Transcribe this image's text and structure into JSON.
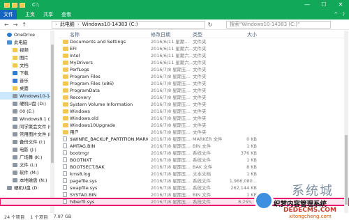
{
  "window": {
    "title": "C:\\",
    "controls": [
      "—",
      "☐",
      "✕"
    ]
  },
  "ribbon": {
    "file_tab": "文件",
    "tabs": [
      "主页",
      "共享",
      "查看"
    ],
    "right": [
      "^",
      "?"
    ]
  },
  "address": {
    "path": [
      "此电脑",
      "Windows10-14383 (C:)"
    ],
    "search_placeholder": "搜索\"Windows10-14383 (C:)\""
  },
  "nav": [
    {
      "label": "OneDrive",
      "icon": "cloud",
      "sub": false,
      "selected": false
    },
    {
      "label": "此电脑",
      "icon": "pc",
      "sub": false,
      "selected": false
    },
    {
      "label": "视频",
      "icon": "folder",
      "sub": true,
      "selected": false
    },
    {
      "label": "图片",
      "icon": "folder",
      "sub": true,
      "selected": false
    },
    {
      "label": "文档",
      "icon": "folder",
      "sub": true,
      "selected": false
    },
    {
      "label": "下载",
      "icon": "dl",
      "sub": true,
      "selected": false
    },
    {
      "label": "音乐",
      "icon": "music",
      "sub": true,
      "selected": false
    },
    {
      "label": "桌面",
      "icon": "folder",
      "sub": true,
      "selected": false
    },
    {
      "label": "Windows10-14",
      "icon": "drive",
      "sub": true,
      "selected": true
    },
    {
      "label": "硬机U盘 (D:)",
      "icon": "drive",
      "sub": true,
      "selected": false
    },
    {
      "label": "00 (E:)",
      "icon": "drive",
      "sub": true,
      "selected": false
    },
    {
      "label": "Windows8.1 (F",
      "icon": "drive",
      "sub": true,
      "selected": false
    },
    {
      "label": "同学聚会文件 (G",
      "icon": "drive",
      "sub": true,
      "selected": false
    },
    {
      "label": "常用图片文件 (H",
      "icon": "drive",
      "sub": true,
      "selected": false
    },
    {
      "label": "备份文件 (I:)",
      "icon": "drive",
      "sub": true,
      "selected": false
    },
    {
      "label": "电影 (J:)",
      "icon": "drive",
      "sub": true,
      "selected": false
    },
    {
      "label": "广场舞 (K:)",
      "icon": "drive",
      "sub": true,
      "selected": false
    },
    {
      "label": "文件 (L:)",
      "icon": "drive",
      "sub": true,
      "selected": false
    },
    {
      "label": "软件 (M:)",
      "icon": "drive",
      "sub": true,
      "selected": false
    },
    {
      "label": "本地磁盘 (N:)",
      "icon": "drive",
      "sub": true,
      "selected": false
    },
    {
      "label": "硬机U盘 (D:",
      "icon": "drive",
      "sub": false,
      "selected": false
    }
  ],
  "columns": {
    "name": "名称",
    "date": "修改日期",
    "type": "类型",
    "size": "大小"
  },
  "files": [
    {
      "name": "Documents and Settings",
      "date": "2016/6/11 星期...",
      "type": "文件夹",
      "size": "",
      "kind": "folder"
    },
    {
      "name": "EFI",
      "date": "2016/6/11 星期六...",
      "type": "文件夹",
      "size": "",
      "kind": "folder"
    },
    {
      "name": "Intel",
      "date": "2016/6/11 星期六...",
      "type": "文件夹",
      "size": "",
      "kind": "folder"
    },
    {
      "name": "MyDrivers",
      "date": "2016/6/11 星期六...",
      "type": "文件夹",
      "size": "",
      "kind": "folder"
    },
    {
      "name": "PerfLogs",
      "date": "2016/7/8 星期五...",
      "type": "文件夹",
      "size": "",
      "kind": "folder"
    },
    {
      "name": "Program Files",
      "date": "2016/7/8 星期五...",
      "type": "文件夹",
      "size": "",
      "kind": "folder"
    },
    {
      "name": "Program Files (x86)",
      "date": "2016/7/8 星期五...",
      "type": "文件夹",
      "size": "",
      "kind": "folder"
    },
    {
      "name": "ProgramData",
      "date": "2016/7/8 星期五...",
      "type": "文件夹",
      "size": "",
      "kind": "folder"
    },
    {
      "name": "Recovery",
      "date": "2016/7/8 星期五...",
      "type": "文件夹",
      "size": "",
      "kind": "folder"
    },
    {
      "name": "System Volume Information",
      "date": "2016/7/8 星期五...",
      "type": "文件夹",
      "size": "",
      "kind": "folder"
    },
    {
      "name": "Windows",
      "date": "2016/7/8 星期五...",
      "type": "文件夹",
      "size": "",
      "kind": "folder"
    },
    {
      "name": "Windows.old",
      "date": "2016/7/8 星期五...",
      "type": "文件夹",
      "size": "",
      "kind": "folder"
    },
    {
      "name": "Windows10Upgrade",
      "date": "2016/7/8 星期五...",
      "type": "文件夹",
      "size": "",
      "kind": "folder"
    },
    {
      "name": "用户",
      "date": "2016/7/8 星期五...",
      "type": "文件夹",
      "size": "",
      "kind": "folder"
    },
    {
      "name": "$WINRE_BACKUP_PARTITION.MARKER",
      "date": "2016/7/8 星期五...",
      "type": "MARKER 文件",
      "size": "0 KB",
      "kind": "file"
    },
    {
      "name": "AMTAG.BIN",
      "date": "2016/7/8 星期五...",
      "type": "BIN 文件",
      "size": "1 KB",
      "kind": "file"
    },
    {
      "name": "bootmgr",
      "date": "2016/7/8 星期五...",
      "type": "系统文件",
      "size": "376 KB",
      "kind": "file"
    },
    {
      "name": "BOOTNXT",
      "date": "2016/7/8 星期五...",
      "type": "系统文件",
      "size": "1 KB",
      "kind": "file"
    },
    {
      "name": "BOOTSECT.BAK",
      "date": "2016/7/8 星期五...",
      "type": "BAK 文件",
      "size": "8 KB",
      "kind": "file"
    },
    {
      "name": "kms8.log",
      "date": "2016/7/8 星期五...",
      "type": "文本文档",
      "size": "1 KB",
      "kind": "file"
    },
    {
      "name": "pagefile.sys",
      "date": "2016/7/8 星期五...",
      "type": "系统文件",
      "size": "1,966,080...",
      "kind": "file"
    },
    {
      "name": "swapfile.sys",
      "date": "2016/7/8 星期五...",
      "type": "系统文件",
      "size": "262,144 KB",
      "kind": "file"
    },
    {
      "name": "SYSTAG.BIN",
      "date": "2016/7/8 星期五...",
      "type": "BIN 文件",
      "size": "1 KB",
      "kind": "file"
    },
    {
      "name": "hiberfil.sys",
      "date": "2016/7/8 星期五...",
      "type": "系统文件",
      "size": "8,255,...",
      "kind": "file",
      "highlighted": true
    }
  ],
  "status": {
    "count": "24 个项目",
    "selected": "1 个项目",
    "size": "7.87 GB"
  },
  "watermark": {
    "brand": "系统城",
    "tagline": "织梦内容管理系统",
    "domain": "DEDECMS.COM",
    "domain2": "xitongcheng.com"
  },
  "colors": {
    "titlebar": "#12a85a",
    "file_tab": "#1565c0",
    "highlight": "#e8186c",
    "selected_nav": "#cce8ff"
  }
}
